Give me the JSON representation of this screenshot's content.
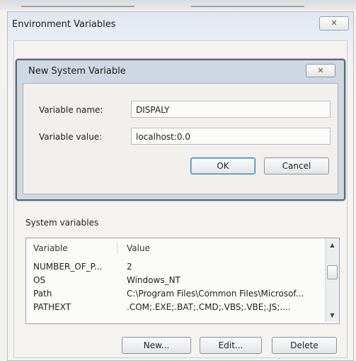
{
  "outer_dialog": {
    "title": "Environment Variables",
    "close_glyph": "✕"
  },
  "inner_dialog": {
    "title": "New System Variable",
    "close_glyph": "✕",
    "name_label": "Variable name:",
    "name_value": "DISPALY",
    "value_label": "Variable value:",
    "value_value": "localhost:0.0",
    "ok_label": "OK",
    "cancel_label": "Cancel"
  },
  "system_variables": {
    "section_label": "System variables",
    "columns": [
      "Variable",
      "Value"
    ],
    "rows": [
      {
        "name": "NUMBER_OF_P...",
        "value": "2"
      },
      {
        "name": "OS",
        "value": "Windows_NT"
      },
      {
        "name": "Path",
        "value": "C:\\Program Files\\Common Files\\Microsof..."
      },
      {
        "name": "PATHEXT",
        "value": ".COM;.EXE;.BAT;.CMD;.VBS;.VBE;.JS;...."
      }
    ],
    "new_label": "New...",
    "edit_label": "Edit...",
    "delete_label": "Delete"
  },
  "icons": {
    "scroll_up": "▲",
    "scroll_down": "▼"
  }
}
